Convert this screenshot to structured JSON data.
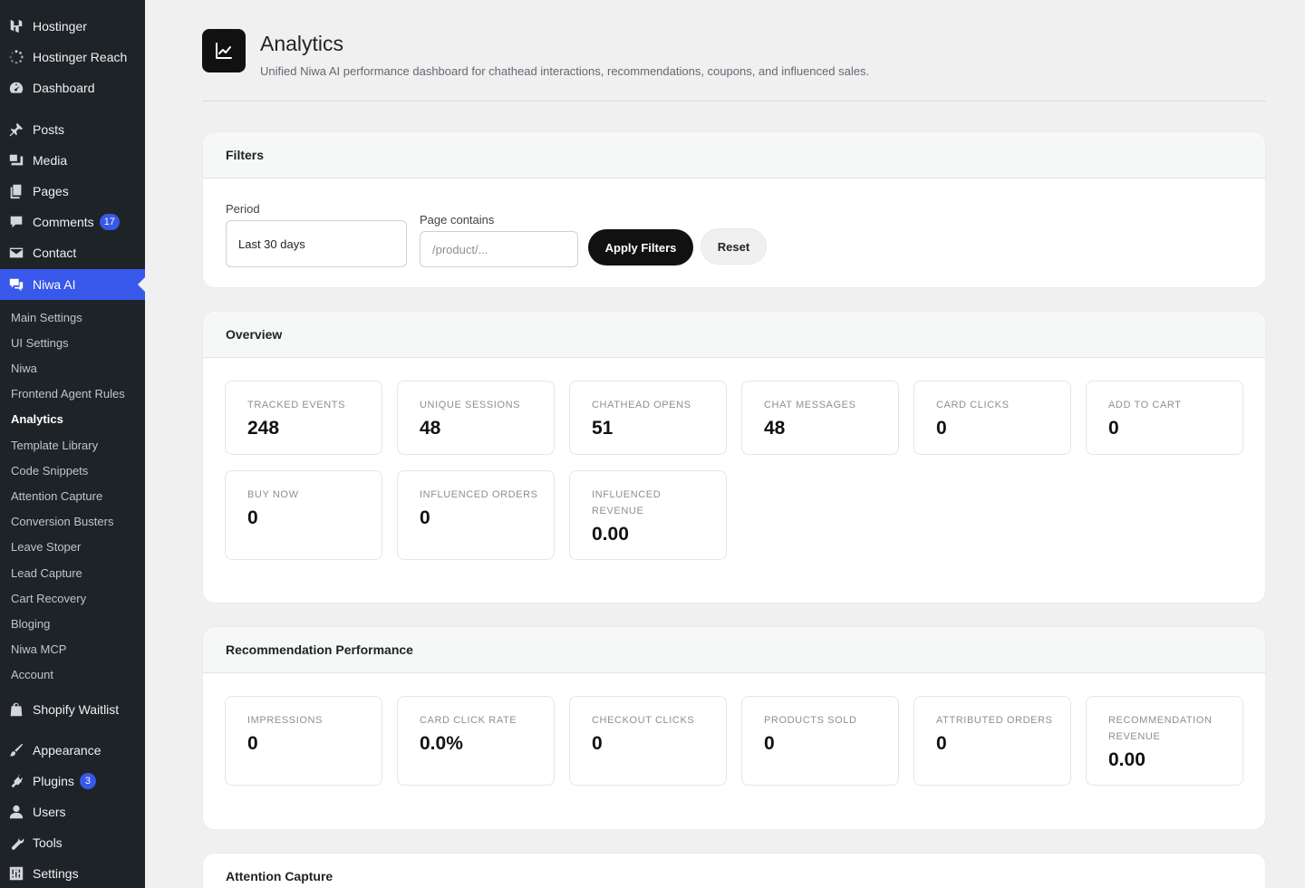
{
  "sidebar": {
    "items": [
      {
        "label": "Hostinger",
        "icon": "hostinger-logo-icon"
      },
      {
        "label": "Hostinger Reach",
        "icon": "spinner-icon"
      },
      {
        "label": "Dashboard",
        "icon": "dashboard-gauge-icon"
      },
      {
        "label": "Posts",
        "icon": "pushpin-icon"
      },
      {
        "label": "Media",
        "icon": "media-icon"
      },
      {
        "label": "Pages",
        "icon": "pages-icon"
      },
      {
        "label": "Comments",
        "icon": "comment-bubble-icon",
        "badge": "17"
      },
      {
        "label": "Contact",
        "icon": "envelope-icon"
      },
      {
        "label": "Niwa AI",
        "icon": "chat-bubbles-icon"
      },
      {
        "label": "Shopify Waitlist",
        "icon": "shopify-bag-icon"
      },
      {
        "label": "Appearance",
        "icon": "paintbrush-icon"
      },
      {
        "label": "Plugins",
        "icon": "plug-icon",
        "badge": "3"
      },
      {
        "label": "Users",
        "icon": "user-icon"
      },
      {
        "label": "Tools",
        "icon": "wrench-icon"
      },
      {
        "label": "Settings",
        "icon": "sliders-icon"
      }
    ],
    "submenu": [
      "Main Settings",
      "UI Settings",
      "Niwa",
      "Frontend Agent Rules",
      "Analytics",
      "Template Library",
      "Code Snippets",
      "Attention Capture",
      "Conversion Busters",
      "Leave Stoper",
      "Lead Capture",
      "Cart Recovery",
      "Bloging",
      "Niwa MCP",
      "Account"
    ],
    "current_submenu": "Analytics"
  },
  "header": {
    "icon": "line-chart-icon",
    "title": "Analytics",
    "subtitle": "Unified Niwa AI performance dashboard for chathead interactions, recommendations, coupons, and influenced sales."
  },
  "filters": {
    "heading": "Filters",
    "period_label": "Period",
    "period_value": "Last 30 days",
    "page_label": "Page contains",
    "page_placeholder": "/product/...",
    "apply_label": "Apply Filters",
    "reset_label": "Reset"
  },
  "overview": {
    "heading": "Overview",
    "stats": [
      {
        "label": "TRACKED EVENTS",
        "value": "248"
      },
      {
        "label": "UNIQUE SESSIONS",
        "value": "48"
      },
      {
        "label": "CHATHEAD OPENS",
        "value": "51"
      },
      {
        "label": "CHAT MESSAGES",
        "value": "48"
      },
      {
        "label": "CARD CLICKS",
        "value": "0"
      },
      {
        "label": "ADD TO CART",
        "value": "0"
      },
      {
        "label": "BUY NOW",
        "value": "0"
      },
      {
        "label": "INFLUENCED ORDERS",
        "value": "0"
      },
      {
        "label": "INFLUENCED REVENUE",
        "value": "0.00"
      }
    ]
  },
  "recommendation": {
    "heading": "Recommendation Performance",
    "stats": [
      {
        "label": "IMPRESSIONS",
        "value": "0"
      },
      {
        "label": "CARD CLICK RATE",
        "value": "0.0%"
      },
      {
        "label": "CHECKOUT CLICKS",
        "value": "0"
      },
      {
        "label": "PRODUCTS SOLD",
        "value": "0"
      },
      {
        "label": "ATTRIBUTED ORDERS",
        "value": "0"
      },
      {
        "label": "RECOMMENDATION REVENUE",
        "value": "0.00"
      }
    ]
  },
  "attention": {
    "heading": "Attention Capture"
  },
  "colors": {
    "sidebar_bg": "#1d2327",
    "active_menu": "#3858e9",
    "badge": "#3858e9",
    "primary_button": "#111111"
  }
}
